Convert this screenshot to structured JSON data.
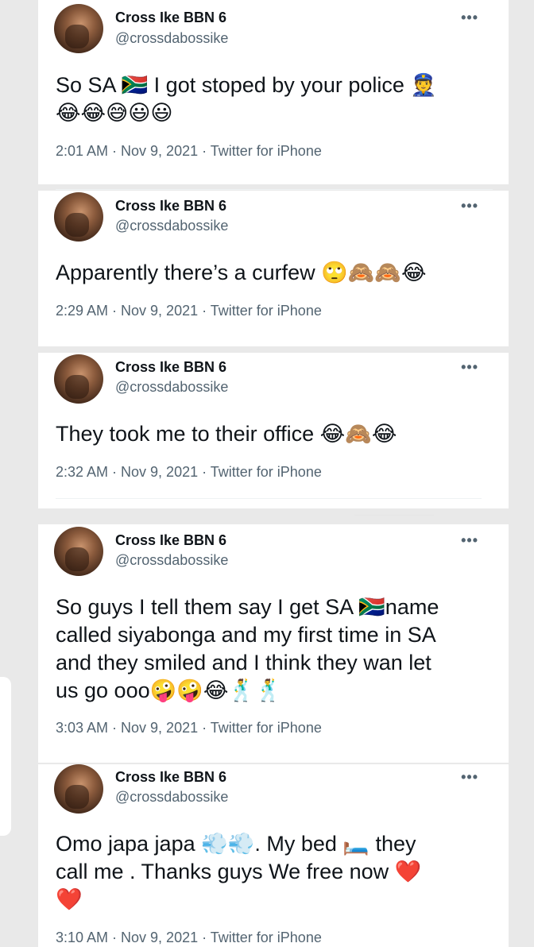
{
  "tweets": [
    {
      "name": "Cross Ike BBN 6",
      "handle": "@crossdabossike",
      "more": "•••",
      "line1": "So SA 🇿🇦 I got stoped by your police 👮",
      "line2": "😂😂😅😃😃",
      "meta": "2:01 AM · Nov 9, 2021 · Twitter for iPhone"
    },
    {
      "name": "Cross Ike BBN 6",
      "handle": "@crossdabossike",
      "more": "•••",
      "line1": "Apparently there’s a curfew 🙄🙈🙈😂",
      "meta": "2:29 AM · Nov 9, 2021 · Twitter for iPhone"
    },
    {
      "name": "Cross Ike BBN 6",
      "handle": "@crossdabossike",
      "more": "•••",
      "line1": "They took me to their office 😂🙈😂",
      "meta": "2:32 AM · Nov 9, 2021 · Twitter for iPhone"
    },
    {
      "name": "Cross Ike BBN 6",
      "handle": "@crossdabossike",
      "more": "•••",
      "line1": "So guys I tell them say I get SA 🇿🇦name",
      "line2": "called siyabonga and my first time in SA",
      "line3": "and they smiled and I think they wan let",
      "line4": "us go ooo🤪🤪😂🕺🕺",
      "meta": "3:03 AM · Nov 9, 2021 · Twitter for iPhone"
    },
    {
      "name": "Cross Ike BBN 6",
      "handle": "@crossdabossike",
      "more": "•••",
      "line1": "Omo japa japa 💨💨.  My bed 🛏️ they",
      "line2": "call me . Thanks guys We free now ❤️",
      "line3": "❤️",
      "meta": "3:10 AM · Nov 9, 2021 · Twitter for iPhone"
    }
  ]
}
